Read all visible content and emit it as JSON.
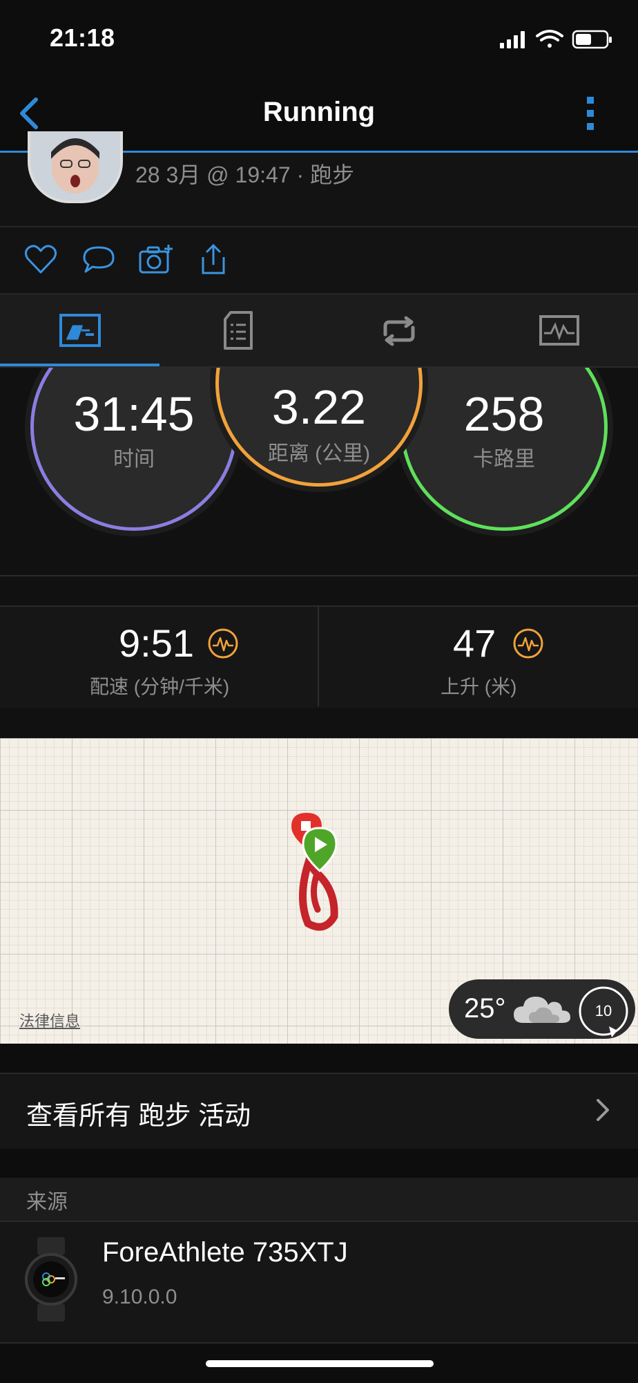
{
  "status_bar": {
    "time": "21:18"
  },
  "nav": {
    "title": "Running"
  },
  "activity": {
    "meta": "28 3月 @ 19:47 · 跑步"
  },
  "rings": {
    "time": {
      "value": "31:45",
      "label": "时间",
      "color": "#8a7ee0"
    },
    "distance": {
      "value": "3.22",
      "label": "距离 (公里)",
      "color": "#f2a23a"
    },
    "calories": {
      "value": "258",
      "label": "卡路里",
      "color": "#5fe05a"
    }
  },
  "stats": {
    "pace": {
      "value": "9:51",
      "label": "配速 (分钟/千米)"
    },
    "elevation": {
      "value": "47",
      "label": "上升 (米)"
    }
  },
  "map": {
    "legal_label": "法律信息",
    "weather_temp": "25°",
    "weather_badge": "10"
  },
  "see_all": {
    "label": "查看所有 跑步 活动"
  },
  "source": {
    "header": "来源",
    "device_name": "ForeAthlete 735XTJ",
    "version": "9.10.0.0"
  },
  "colors": {
    "accent": "#2e8ad8",
    "gauge": "#f2a23a",
    "route": "#c4242a"
  }
}
